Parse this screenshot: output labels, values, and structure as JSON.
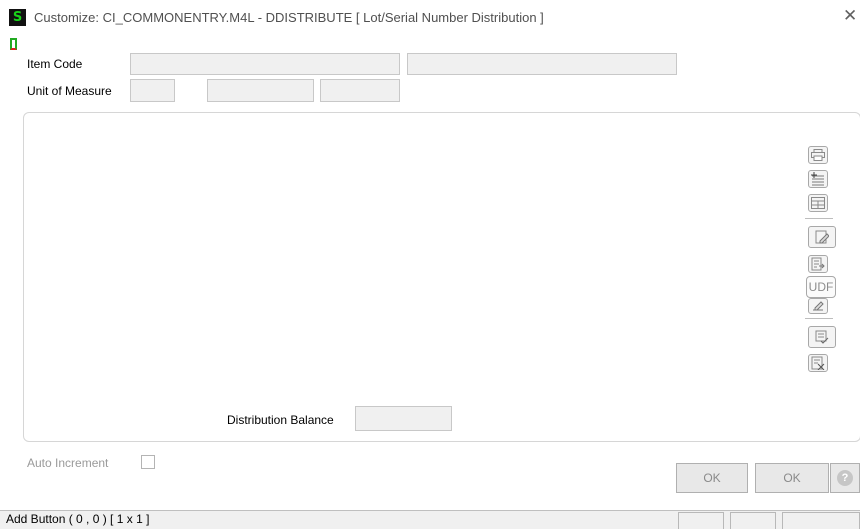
{
  "window": {
    "icon_glyph": "S",
    "title": "Customize: CI_COMMONENTRY.M4L - DDISTRIBUTE  [ Lot/Serial Number Distribution ]",
    "close_glyph": "✕"
  },
  "form": {
    "item_code_label": "Item Code",
    "item_code_value": "",
    "item_desc_value": "",
    "uom_label": "Unit of Measure",
    "uom_value": "",
    "uom_field2_value": "",
    "uom_field3_value": "",
    "distribution_balance_label": "Distribution Balance",
    "distribution_balance_value": "",
    "auto_increment_label": "Auto Increment",
    "auto_increment_checked": false
  },
  "toolbar": {
    "icons": [
      "print-icon",
      "insert-line-icon",
      "grid-icon",
      "edit-icon",
      "export-icon",
      "udf-icon",
      "clear-icon",
      "apply-icon",
      "delete-icon"
    ],
    "udf_label": "UDF"
  },
  "buttons": {
    "ok1_label": "OK",
    "ok2_label": "OK",
    "help_glyph": "?"
  },
  "statusbar": {
    "text": "Add Button  ( 0 , 0 )  [ 1 x 1 ]"
  }
}
